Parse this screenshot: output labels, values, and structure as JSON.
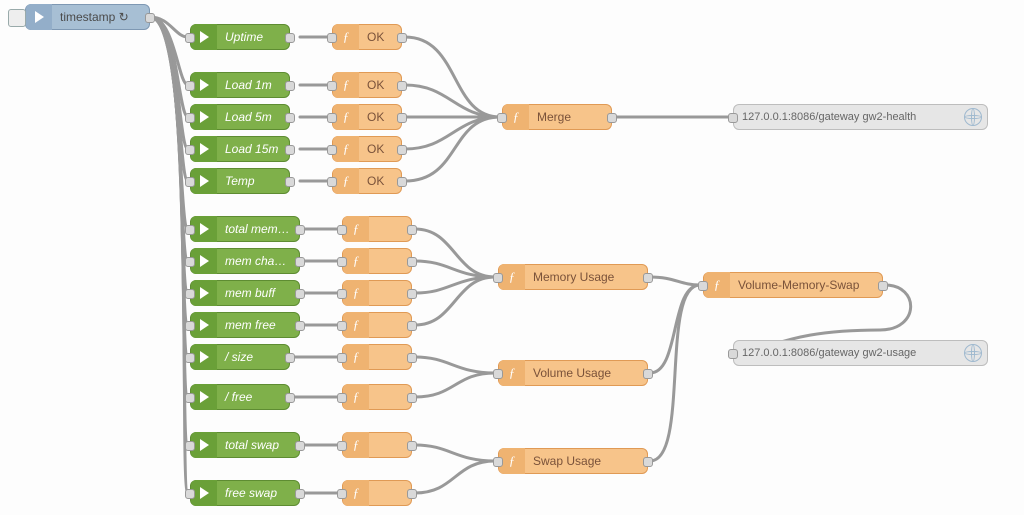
{
  "inject": {
    "label": "timestamp ↻"
  },
  "green": [
    {
      "label": "Uptime"
    },
    {
      "label": "Load 1m"
    },
    {
      "label": "Load 5m"
    },
    {
      "label": "Load 15m"
    },
    {
      "label": "Temp"
    },
    {
      "label": "total memory"
    },
    {
      "label": "mem chached"
    },
    {
      "label": "mem buff"
    },
    {
      "label": "mem free"
    },
    {
      "label": "/ size"
    },
    {
      "label": "/ free"
    },
    {
      "label": "total swap"
    },
    {
      "label": "free swap"
    }
  ],
  "func_ok": [
    {
      "label": "OK"
    },
    {
      "label": "OK"
    },
    {
      "label": "OK"
    },
    {
      "label": "OK"
    },
    {
      "label": "OK"
    }
  ],
  "func_small_count": 8,
  "merge": {
    "label": "Merge"
  },
  "mem_usage": {
    "label": "Memory Usage"
  },
  "vol_usage": {
    "label": "Volume Usage"
  },
  "swap_usage": {
    "label": "Swap Usage"
  },
  "vms": {
    "label": "Volume-Memory-Swap"
  },
  "http": [
    {
      "label": "127.0.0.1:8086/gateway gw2-health"
    },
    {
      "label": "127.0.0.1:8086/gateway gw2-usage"
    }
  ],
  "fx_glyph": "ƒ"
}
